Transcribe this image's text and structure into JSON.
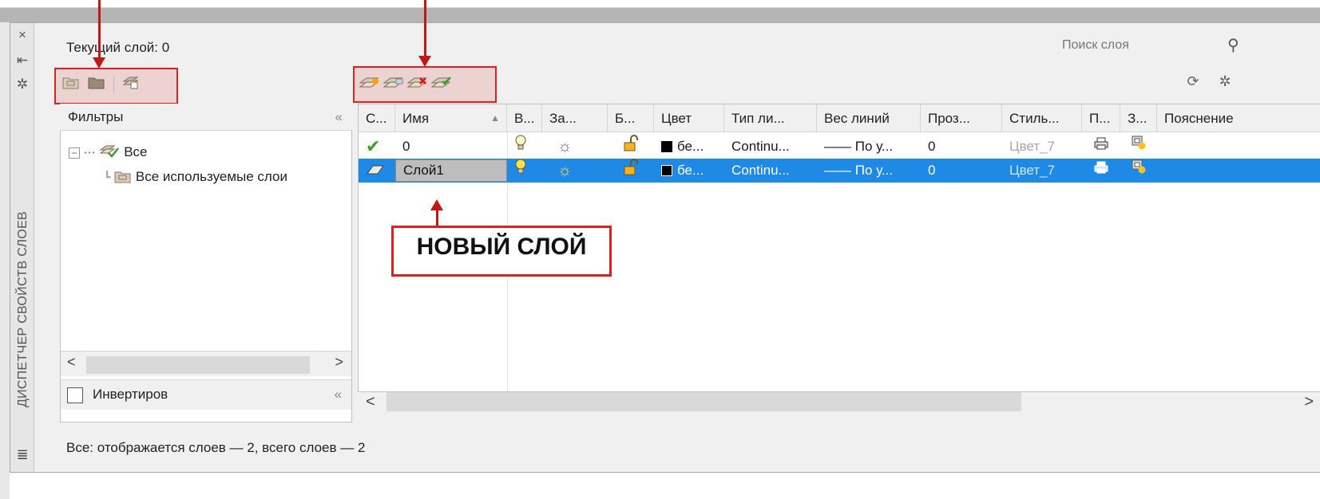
{
  "window": {
    "vertical_title": "ДИСПЕТЧЕР СВОЙСТВ СЛОЕВ",
    "current_layer_label": "Текущий слой: 0",
    "close_icon": "×",
    "autohide_icon": "⇤",
    "properties_icon": "✲",
    "palette_icon": "≣"
  },
  "search": {
    "placeholder": "Поиск слоя",
    "icon": "⚲"
  },
  "filter_toolbar": {
    "buttons": [
      "new-property-filter",
      "new-group-filter",
      "layer-states-manager"
    ]
  },
  "layer_toolbar": {
    "buttons": [
      "new-layer",
      "new-layer-vp-frozen",
      "delete-layer",
      "set-current"
    ]
  },
  "filters": {
    "header": "Фильтры",
    "collapse": "«",
    "tree": [
      {
        "label": "Все",
        "toggle": "−"
      },
      {
        "label": "Все используемые слои"
      }
    ],
    "invert_label": "Инвертиров",
    "scroll_left": "<",
    "scroll_right": ">"
  },
  "grid": {
    "columns": [
      "С...",
      "Имя",
      "В...",
      "За...",
      "Б...",
      "Цвет",
      "Тип ли...",
      "Вес линий",
      "Проз...",
      "Стиль...",
      "П...",
      "З...",
      "Пояснение"
    ],
    "sort_indicator": "▲",
    "rows": [
      {
        "status": "✔",
        "name": "0",
        "on": "💡",
        "freeze": "☼",
        "lock": "🔓",
        "color": "бе...",
        "linetype": "Continu...",
        "lineweight": "—— По у...",
        "transparency": "0",
        "plot_style": "Цвет_7",
        "plot": "🖶",
        "new_vp": "⧉",
        "selected": false
      },
      {
        "status": "▱",
        "name": "Слой1",
        "on": "💡",
        "freeze": "☼",
        "lock": "🔓",
        "color": "бе...",
        "linetype": "Continu...",
        "lineweight": "—— По у...",
        "transparency": "0",
        "plot_style": "Цвет_7",
        "plot": "🖶",
        "new_vp": "⧉",
        "selected": true
      }
    ],
    "hscroll_left": "<",
    "hscroll_right": ">"
  },
  "status_bar": {
    "text": "Все: отображается слоев — 2, всего слоев — 2"
  },
  "callout": {
    "text": "НОВЫЙ СЛОЙ"
  },
  "colors": {
    "accent_red": "#e02020",
    "selection_blue": "#1e8ae6"
  }
}
